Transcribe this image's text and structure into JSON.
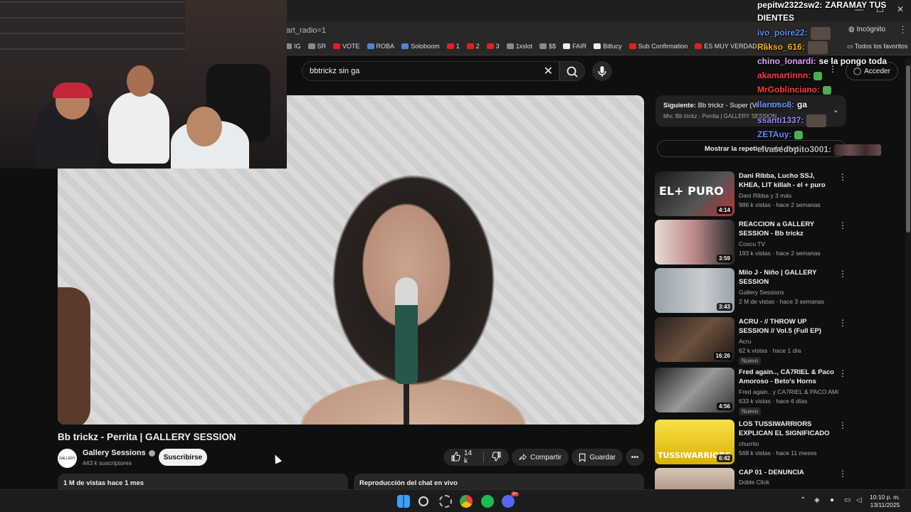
{
  "browser": {
    "url_fragment": "art_radio=1",
    "incognito_label": "Incógnito",
    "bookmarks": [
      "IG",
      "SR",
      "VOTE",
      "ROBA",
      "Soloboom",
      "1",
      "2",
      "3",
      "1xslot",
      "$$",
      "FAIR",
      "Bitlucy",
      "Sub Confirmation",
      "ES MUY VERDAD PE..."
    ],
    "all_favorites": "Todos los favoritos"
  },
  "search": {
    "query": "bbtrickz sin ga"
  },
  "header": {
    "signin_label": "Acceder"
  },
  "video": {
    "title": "Bb trickz - Perrita | GALLERY SESSION",
    "channel": "Gallery Sessions",
    "channel_avatar_text": "GALLERY",
    "subscribers": "443 k suscriptores",
    "subscribe_label": "Suscribirse",
    "likes": "14 k",
    "share_label": "Compartir",
    "save_label": "Guardar",
    "views_date": "1 M de vistas  hace 1 mes",
    "chat_replay_label": "Reproducción del chat en vivo"
  },
  "sidebar": {
    "next_title_bold": "Siguiente:",
    "next_title": "Bb trickz - Super (Video Oficial)",
    "next_sub": "Mix: Bb trickz - Perrita | GALLERY SESSION",
    "replay_button": "Mostrar la repetición del chat",
    "recommendations": [
      {
        "title": "Dani Ribba, Lucho SSJ, KHEA, LIT killah - el + puro (Video ...",
        "channel": "Dani Ribba",
        "channel_extra": "y 3 más",
        "meta": "986 k vistas · hace 2 semanas",
        "duration": "4:14",
        "thumb_text": "EL+ PURO",
        "new": ""
      },
      {
        "title": "REACCION a GALLERY SESSION - Bb trickz",
        "channel": "Coscu TV",
        "channel_extra": "",
        "meta": "193 k vistas · hace 2 semanas",
        "duration": "3:59",
        "thumb_text": "",
        "new": ""
      },
      {
        "title": "Milo J - Niño | GALLERY SESSION",
        "channel": "Gallery Sessions",
        "channel_extra": "",
        "meta": "2 M de vistas · hace 3 semanas",
        "duration": "3:43",
        "thumb_text": "",
        "new": ""
      },
      {
        "title": "ACRU - // THROW UP SESSION // Vol.5 (Full EP)",
        "channel": "Acru",
        "channel_extra": "",
        "meta": "62 k vistas · hace 1 día",
        "duration": "16:26",
        "thumb_text": "",
        "new": "Nuevo"
      },
      {
        "title": "Fred again.., CA7RIEL & Paco Amoroso - Beto's Horns (Paris,...",
        "channel": "Fred again..",
        "channel_extra": "y CA7RIEL & PACO AMO...",
        "meta": "633 k vistas · hace 6 días",
        "duration": "4:56",
        "thumb_text": "",
        "new": "Nuevo"
      },
      {
        "title": "LOS TUSSIWARRIORS EXPLICAN EL SIGNIFICADO D...",
        "channel": "churrito",
        "channel_extra": "",
        "meta": "568 k vistas · hace 11 meses",
        "duration": "6:42",
        "thumb_text": "TUSSIWARRIORS",
        "new": ""
      },
      {
        "title": "CAP 01 - DENUNCIA",
        "channel": "Doble Click",
        "channel_extra": "",
        "meta": "",
        "duration": "",
        "thumb_text": "",
        "new": ""
      }
    ]
  },
  "chat": [
    {
      "user": "pepitw2322sw2:",
      "text": "ZARAMAY TUS",
      "color": "#ffffff"
    },
    {
      "user": "",
      "text": "DIENTES",
      "color": "#ffffff"
    },
    {
      "user": "ivo_poire22:",
      "text": "",
      "color": "#5b8ff0"
    },
    {
      "user": "Rakso_616:",
      "text": "",
      "color": "#ffb000"
    },
    {
      "user": "chino_lonardi:",
      "text": "se la pongo toda",
      "color": "#e0a0ff"
    },
    {
      "user": "akamartinnn:",
      "text": "",
      "color": "#ff3a3a"
    },
    {
      "user": "MrGoblinciano:",
      "text": "",
      "color": "#ff3a3a"
    },
    {
      "user": "llanosc8:",
      "text": "ga",
      "color": "#5b8ff0"
    },
    {
      "user": "ssanti1337:",
      "text": "",
      "color": "#9a8cff"
    },
    {
      "user": "ZETAuy:",
      "text": "",
      "color": "#5b8ff0"
    },
    {
      "user": "elvasedopito3001:",
      "text": "",
      "color": "#bbbbbb"
    }
  ],
  "taskbar": {
    "time": "10:10 p. m.",
    "date": "13/11/2025",
    "discord_badge": "9+"
  }
}
